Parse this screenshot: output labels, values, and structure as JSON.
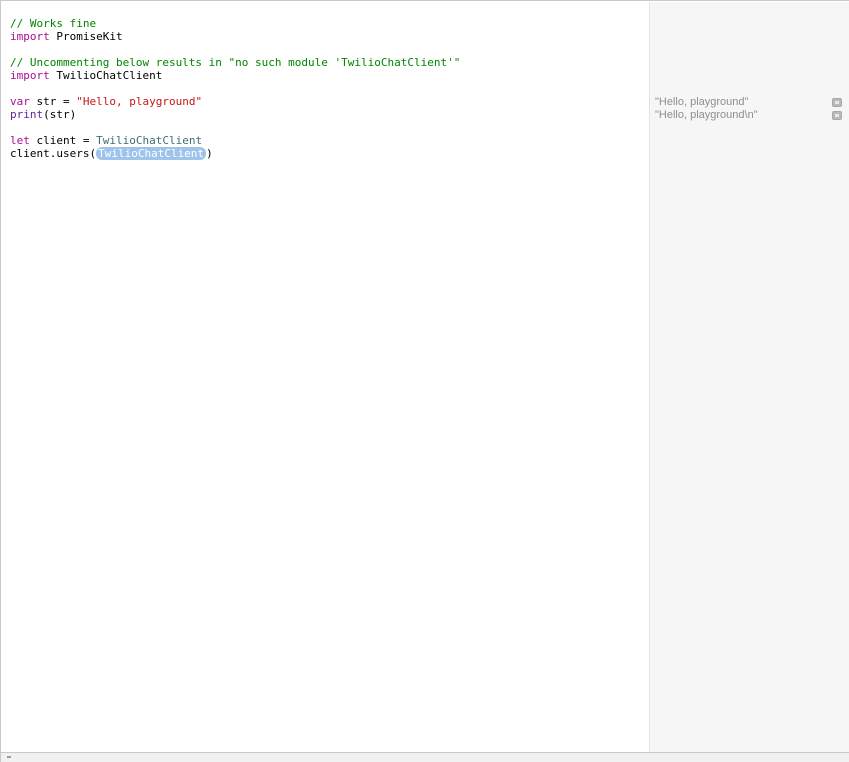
{
  "editor": {
    "lines": [
      [
        {
          "t": "// Works fine",
          "k": "comment"
        }
      ],
      [
        {
          "t": "import",
          "k": "keyword"
        },
        {
          "t": " PromiseKit",
          "k": "plain"
        }
      ],
      [],
      [
        {
          "t": "// Uncommenting below results in \"no such module 'TwilioChatClient'\"",
          "k": "comment"
        }
      ],
      [
        {
          "t": "import",
          "k": "keyword"
        },
        {
          "t": " TwilioChatClient",
          "k": "plain"
        }
      ],
      [],
      [
        {
          "t": "var",
          "k": "keyword"
        },
        {
          "t": " str = ",
          "k": "plain"
        },
        {
          "t": "\"Hello, playground\"",
          "k": "string"
        }
      ],
      [
        {
          "t": "print",
          "k": "func"
        },
        {
          "t": "(str)",
          "k": "plain"
        }
      ],
      [],
      [
        {
          "t": "let",
          "k": "keyword"
        },
        {
          "t": " client = ",
          "k": "plain"
        },
        {
          "t": "TwilioChatClient",
          "k": "type"
        }
      ],
      [
        {
          "t": "client.users(",
          "k": "plain"
        },
        {
          "t": "TwilioChatClient",
          "k": "placeholder"
        },
        {
          "t": ")",
          "k": "plain"
        }
      ]
    ]
  },
  "results": {
    "rows": [
      {
        "line": 6,
        "text": "\"Hello, playground\"",
        "icon": "quick-look-icon"
      },
      {
        "line": 7,
        "text": "\"Hello, playground\\n\"",
        "icon": "quick-look-icon"
      }
    ]
  },
  "colors": {
    "comment": "#008400",
    "keyword": "#aa0d91",
    "string": "#c41a16",
    "type": "#3f6e74",
    "func": "#5c2699",
    "placeholder_bg": "#9fc4ec",
    "results_bg": "#f6f6f6"
  }
}
